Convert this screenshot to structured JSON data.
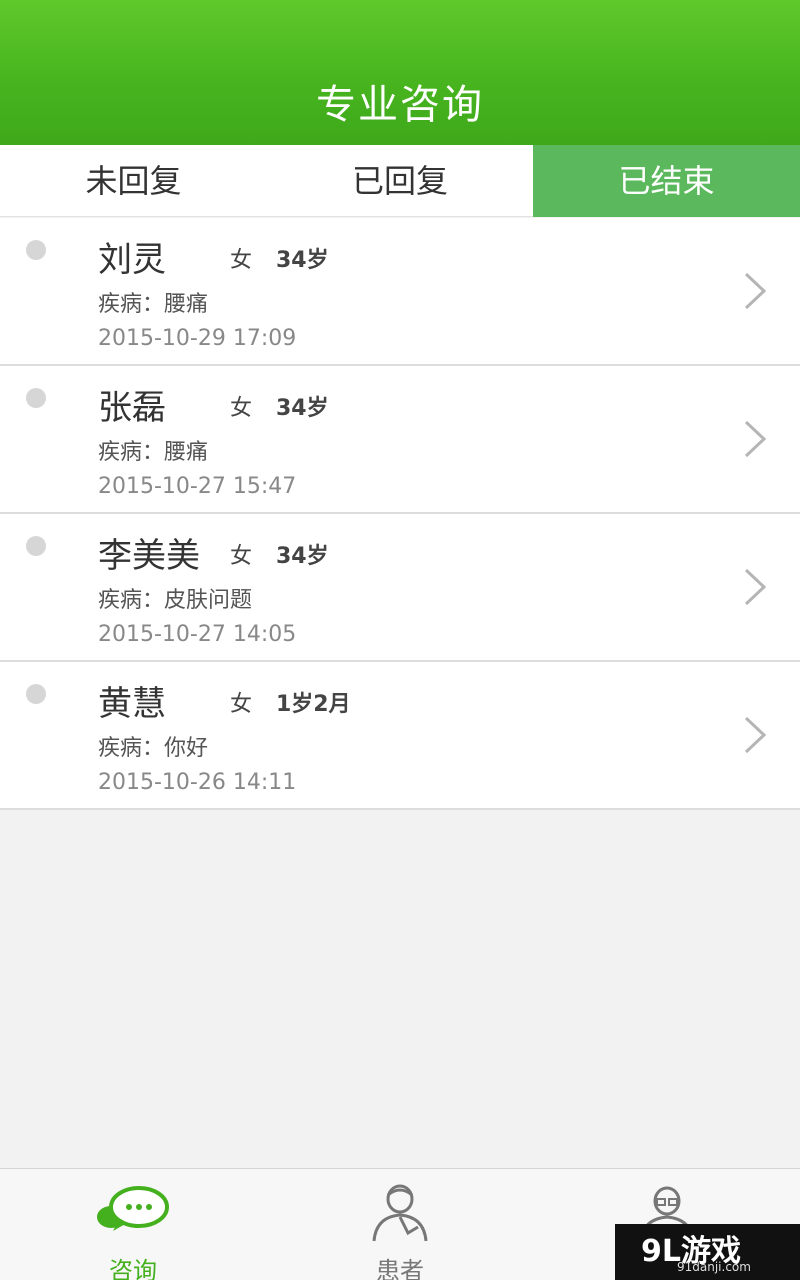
{
  "header": {
    "title": "专业咨询"
  },
  "tabs": [
    {
      "label": "未回复"
    },
    {
      "label": "已回复"
    },
    {
      "label": "已结束",
      "active": true
    }
  ],
  "consultations": [
    {
      "name": "刘灵",
      "gender": "女",
      "age": "34岁",
      "disease": "疾病：腰痛",
      "time": "2015-10-29 17:09"
    },
    {
      "name": "张磊",
      "gender": "女",
      "age": "34岁",
      "disease": "疾病：腰痛",
      "time": "2015-10-27 15:47"
    },
    {
      "name": "李美美",
      "gender": "女",
      "age": "34岁",
      "disease": "疾病：皮肤问题",
      "time": "2015-10-27 14:05"
    },
    {
      "name": "黄慧",
      "gender": "女",
      "age": "1岁2月",
      "disease": "疾病：你好",
      "time": "2015-10-26 14:11"
    }
  ],
  "bottom_nav": [
    {
      "label": "咨询",
      "icon": "chat-bubbles-icon",
      "active": true
    },
    {
      "label": "患者",
      "icon": "patient-icon"
    },
    {
      "label": "",
      "icon": "doctor-icon"
    }
  ],
  "watermark": {
    "big": "9L游戏",
    "small": "91danji.com"
  },
  "colors": {
    "header_green": "#48b51f",
    "active_tab": "#5cb85c",
    "nav_active": "#45b01e"
  }
}
